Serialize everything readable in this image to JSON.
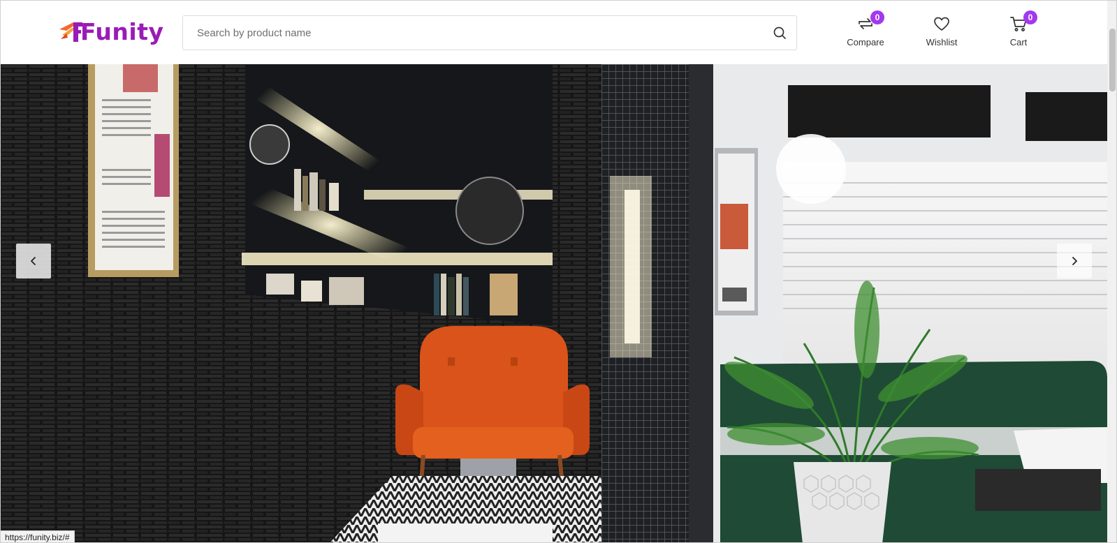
{
  "brand": {
    "name": "Funity",
    "color": "#9b1bb7",
    "accent": "#f26a2e"
  },
  "search": {
    "placeholder": "Search by product name",
    "value": "",
    "icon": "search-icon"
  },
  "header_actions": [
    {
      "label": "Compare",
      "icon": "compare-arrows-icon",
      "count": "0"
    },
    {
      "label": "Wishlist",
      "icon": "heart-icon"
    },
    {
      "label": "Cart",
      "icon": "cart-icon",
      "count": "0"
    }
  ],
  "badge_color": "#a238f0",
  "hero": {
    "image_subject": "interior room with orange armchair, bookshelves, brick wall and palm plant",
    "prev_icon": "chevron-left-icon",
    "next_icon": "chevron-right-icon"
  },
  "status_url": "https://funity.biz/#"
}
